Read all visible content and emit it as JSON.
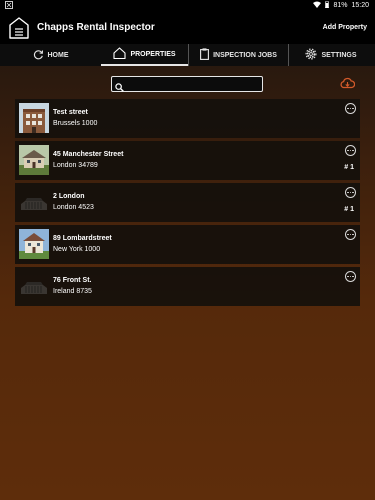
{
  "status": {
    "battery": "81%",
    "time": "15:20"
  },
  "app": {
    "title": "Chapps Rental Inspector",
    "add_property": "Add Property"
  },
  "tabs": [
    {
      "label": "HOME",
      "icon": "refresh-icon",
      "active": false
    },
    {
      "label": "PROPERTIES",
      "icon": "house-icon",
      "active": true
    },
    {
      "label": "INSPECTION JOBS",
      "icon": "clipboard-icon",
      "active": false
    },
    {
      "label": "SETTINGS",
      "icon": "gear-icon",
      "active": false
    }
  ],
  "search": {
    "value": "",
    "placeholder": ""
  },
  "properties": [
    {
      "street": "Test street",
      "city": "Brussels 1000",
      "count": "",
      "thumb": "brick-building-photo"
    },
    {
      "street": "45 Manchester Street",
      "city": "London 34789",
      "count": "# 1",
      "thumb": "house-photo"
    },
    {
      "street": "2 London",
      "city": "London 4523",
      "count": "# 1",
      "thumb": "placeholder-building"
    },
    {
      "street": "89 Lombardstreet",
      "city": "New York 1000",
      "count": "",
      "thumb": "house-photo"
    },
    {
      "street": "76 Front St.",
      "city": "Ireland 8735",
      "count": "",
      "thumb": "placeholder-building"
    }
  ],
  "colors": {
    "background_top": "#1b1410",
    "background_bottom": "#5e2d0b",
    "cloud_accent": "#d35a2a"
  }
}
